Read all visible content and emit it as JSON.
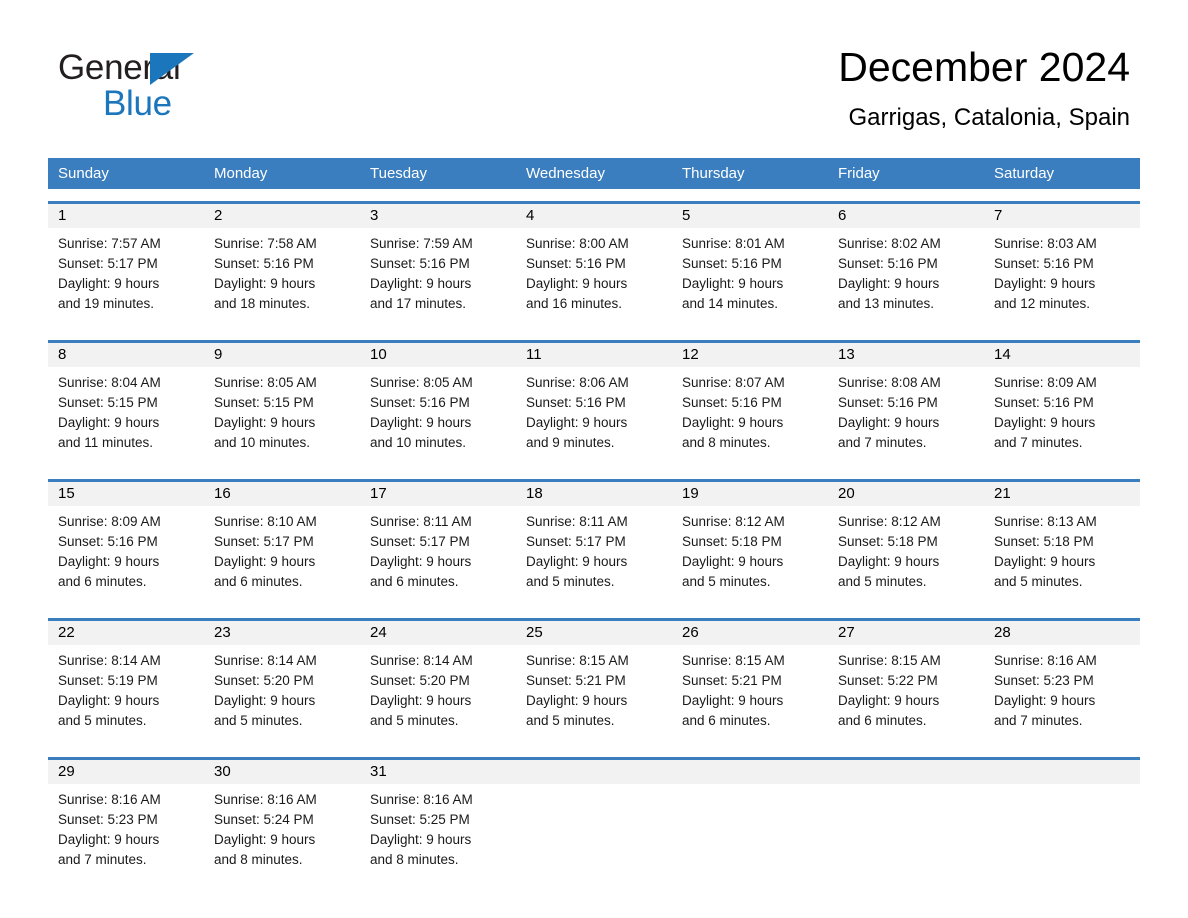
{
  "brand": {
    "name_part1": "General",
    "name_part2": "Blue"
  },
  "header": {
    "month_title": "December 2024",
    "location": "Garrigas, Catalonia, Spain"
  },
  "colors": {
    "header_blue": "#3a7ebf",
    "brand_blue": "#1b76bc",
    "date_band": "#f2f2f2",
    "text": "#000000"
  },
  "weekdays": [
    "Sunday",
    "Monday",
    "Tuesday",
    "Wednesday",
    "Thursday",
    "Friday",
    "Saturday"
  ],
  "weeks": [
    {
      "days": [
        {
          "date": "1",
          "sunrise": "Sunrise: 7:57 AM",
          "sunset": "Sunset: 5:17 PM",
          "daylight_line1": "Daylight: 9 hours",
          "daylight_line2": "and 19 minutes."
        },
        {
          "date": "2",
          "sunrise": "Sunrise: 7:58 AM",
          "sunset": "Sunset: 5:16 PM",
          "daylight_line1": "Daylight: 9 hours",
          "daylight_line2": "and 18 minutes."
        },
        {
          "date": "3",
          "sunrise": "Sunrise: 7:59 AM",
          "sunset": "Sunset: 5:16 PM",
          "daylight_line1": "Daylight: 9 hours",
          "daylight_line2": "and 17 minutes."
        },
        {
          "date": "4",
          "sunrise": "Sunrise: 8:00 AM",
          "sunset": "Sunset: 5:16 PM",
          "daylight_line1": "Daylight: 9 hours",
          "daylight_line2": "and 16 minutes."
        },
        {
          "date": "5",
          "sunrise": "Sunrise: 8:01 AM",
          "sunset": "Sunset: 5:16 PM",
          "daylight_line1": "Daylight: 9 hours",
          "daylight_line2": "and 14 minutes."
        },
        {
          "date": "6",
          "sunrise": "Sunrise: 8:02 AM",
          "sunset": "Sunset: 5:16 PM",
          "daylight_line1": "Daylight: 9 hours",
          "daylight_line2": "and 13 minutes."
        },
        {
          "date": "7",
          "sunrise": "Sunrise: 8:03 AM",
          "sunset": "Sunset: 5:16 PM",
          "daylight_line1": "Daylight: 9 hours",
          "daylight_line2": "and 12 minutes."
        }
      ]
    },
    {
      "days": [
        {
          "date": "8",
          "sunrise": "Sunrise: 8:04 AM",
          "sunset": "Sunset: 5:15 PM",
          "daylight_line1": "Daylight: 9 hours",
          "daylight_line2": "and 11 minutes."
        },
        {
          "date": "9",
          "sunrise": "Sunrise: 8:05 AM",
          "sunset": "Sunset: 5:15 PM",
          "daylight_line1": "Daylight: 9 hours",
          "daylight_line2": "and 10 minutes."
        },
        {
          "date": "10",
          "sunrise": "Sunrise: 8:05 AM",
          "sunset": "Sunset: 5:16 PM",
          "daylight_line1": "Daylight: 9 hours",
          "daylight_line2": "and 10 minutes."
        },
        {
          "date": "11",
          "sunrise": "Sunrise: 8:06 AM",
          "sunset": "Sunset: 5:16 PM",
          "daylight_line1": "Daylight: 9 hours",
          "daylight_line2": "and 9 minutes."
        },
        {
          "date": "12",
          "sunrise": "Sunrise: 8:07 AM",
          "sunset": "Sunset: 5:16 PM",
          "daylight_line1": "Daylight: 9 hours",
          "daylight_line2": "and 8 minutes."
        },
        {
          "date": "13",
          "sunrise": "Sunrise: 8:08 AM",
          "sunset": "Sunset: 5:16 PM",
          "daylight_line1": "Daylight: 9 hours",
          "daylight_line2": "and 7 minutes."
        },
        {
          "date": "14",
          "sunrise": "Sunrise: 8:09 AM",
          "sunset": "Sunset: 5:16 PM",
          "daylight_line1": "Daylight: 9 hours",
          "daylight_line2": "and 7 minutes."
        }
      ]
    },
    {
      "days": [
        {
          "date": "15",
          "sunrise": "Sunrise: 8:09 AM",
          "sunset": "Sunset: 5:16 PM",
          "daylight_line1": "Daylight: 9 hours",
          "daylight_line2": "and 6 minutes."
        },
        {
          "date": "16",
          "sunrise": "Sunrise: 8:10 AM",
          "sunset": "Sunset: 5:17 PM",
          "daylight_line1": "Daylight: 9 hours",
          "daylight_line2": "and 6 minutes."
        },
        {
          "date": "17",
          "sunrise": "Sunrise: 8:11 AM",
          "sunset": "Sunset: 5:17 PM",
          "daylight_line1": "Daylight: 9 hours",
          "daylight_line2": "and 6 minutes."
        },
        {
          "date": "18",
          "sunrise": "Sunrise: 8:11 AM",
          "sunset": "Sunset: 5:17 PM",
          "daylight_line1": "Daylight: 9 hours",
          "daylight_line2": "and 5 minutes."
        },
        {
          "date": "19",
          "sunrise": "Sunrise: 8:12 AM",
          "sunset": "Sunset: 5:18 PM",
          "daylight_line1": "Daylight: 9 hours",
          "daylight_line2": "and 5 minutes."
        },
        {
          "date": "20",
          "sunrise": "Sunrise: 8:12 AM",
          "sunset": "Sunset: 5:18 PM",
          "daylight_line1": "Daylight: 9 hours",
          "daylight_line2": "and 5 minutes."
        },
        {
          "date": "21",
          "sunrise": "Sunrise: 8:13 AM",
          "sunset": "Sunset: 5:18 PM",
          "daylight_line1": "Daylight: 9 hours",
          "daylight_line2": "and 5 minutes."
        }
      ]
    },
    {
      "days": [
        {
          "date": "22",
          "sunrise": "Sunrise: 8:14 AM",
          "sunset": "Sunset: 5:19 PM",
          "daylight_line1": "Daylight: 9 hours",
          "daylight_line2": "and 5 minutes."
        },
        {
          "date": "23",
          "sunrise": "Sunrise: 8:14 AM",
          "sunset": "Sunset: 5:20 PM",
          "daylight_line1": "Daylight: 9 hours",
          "daylight_line2": "and 5 minutes."
        },
        {
          "date": "24",
          "sunrise": "Sunrise: 8:14 AM",
          "sunset": "Sunset: 5:20 PM",
          "daylight_line1": "Daylight: 9 hours",
          "daylight_line2": "and 5 minutes."
        },
        {
          "date": "25",
          "sunrise": "Sunrise: 8:15 AM",
          "sunset": "Sunset: 5:21 PM",
          "daylight_line1": "Daylight: 9 hours",
          "daylight_line2": "and 5 minutes."
        },
        {
          "date": "26",
          "sunrise": "Sunrise: 8:15 AM",
          "sunset": "Sunset: 5:21 PM",
          "daylight_line1": "Daylight: 9 hours",
          "daylight_line2": "and 6 minutes."
        },
        {
          "date": "27",
          "sunrise": "Sunrise: 8:15 AM",
          "sunset": "Sunset: 5:22 PM",
          "daylight_line1": "Daylight: 9 hours",
          "daylight_line2": "and 6 minutes."
        },
        {
          "date": "28",
          "sunrise": "Sunrise: 8:16 AM",
          "sunset": "Sunset: 5:23 PM",
          "daylight_line1": "Daylight: 9 hours",
          "daylight_line2": "and 7 minutes."
        }
      ]
    },
    {
      "days": [
        {
          "date": "29",
          "sunrise": "Sunrise: 8:16 AM",
          "sunset": "Sunset: 5:23 PM",
          "daylight_line1": "Daylight: 9 hours",
          "daylight_line2": "and 7 minutes."
        },
        {
          "date": "30",
          "sunrise": "Sunrise: 8:16 AM",
          "sunset": "Sunset: 5:24 PM",
          "daylight_line1": "Daylight: 9 hours",
          "daylight_line2": "and 8 minutes."
        },
        {
          "date": "31",
          "sunrise": "Sunrise: 8:16 AM",
          "sunset": "Sunset: 5:25 PM",
          "daylight_line1": "Daylight: 9 hours",
          "daylight_line2": "and 8 minutes."
        },
        {
          "date": "",
          "sunrise": "",
          "sunset": "",
          "daylight_line1": "",
          "daylight_line2": ""
        },
        {
          "date": "",
          "sunrise": "",
          "sunset": "",
          "daylight_line1": "",
          "daylight_line2": ""
        },
        {
          "date": "",
          "sunrise": "",
          "sunset": "",
          "daylight_line1": "",
          "daylight_line2": ""
        },
        {
          "date": "",
          "sunrise": "",
          "sunset": "",
          "daylight_line1": "",
          "daylight_line2": ""
        }
      ]
    }
  ]
}
